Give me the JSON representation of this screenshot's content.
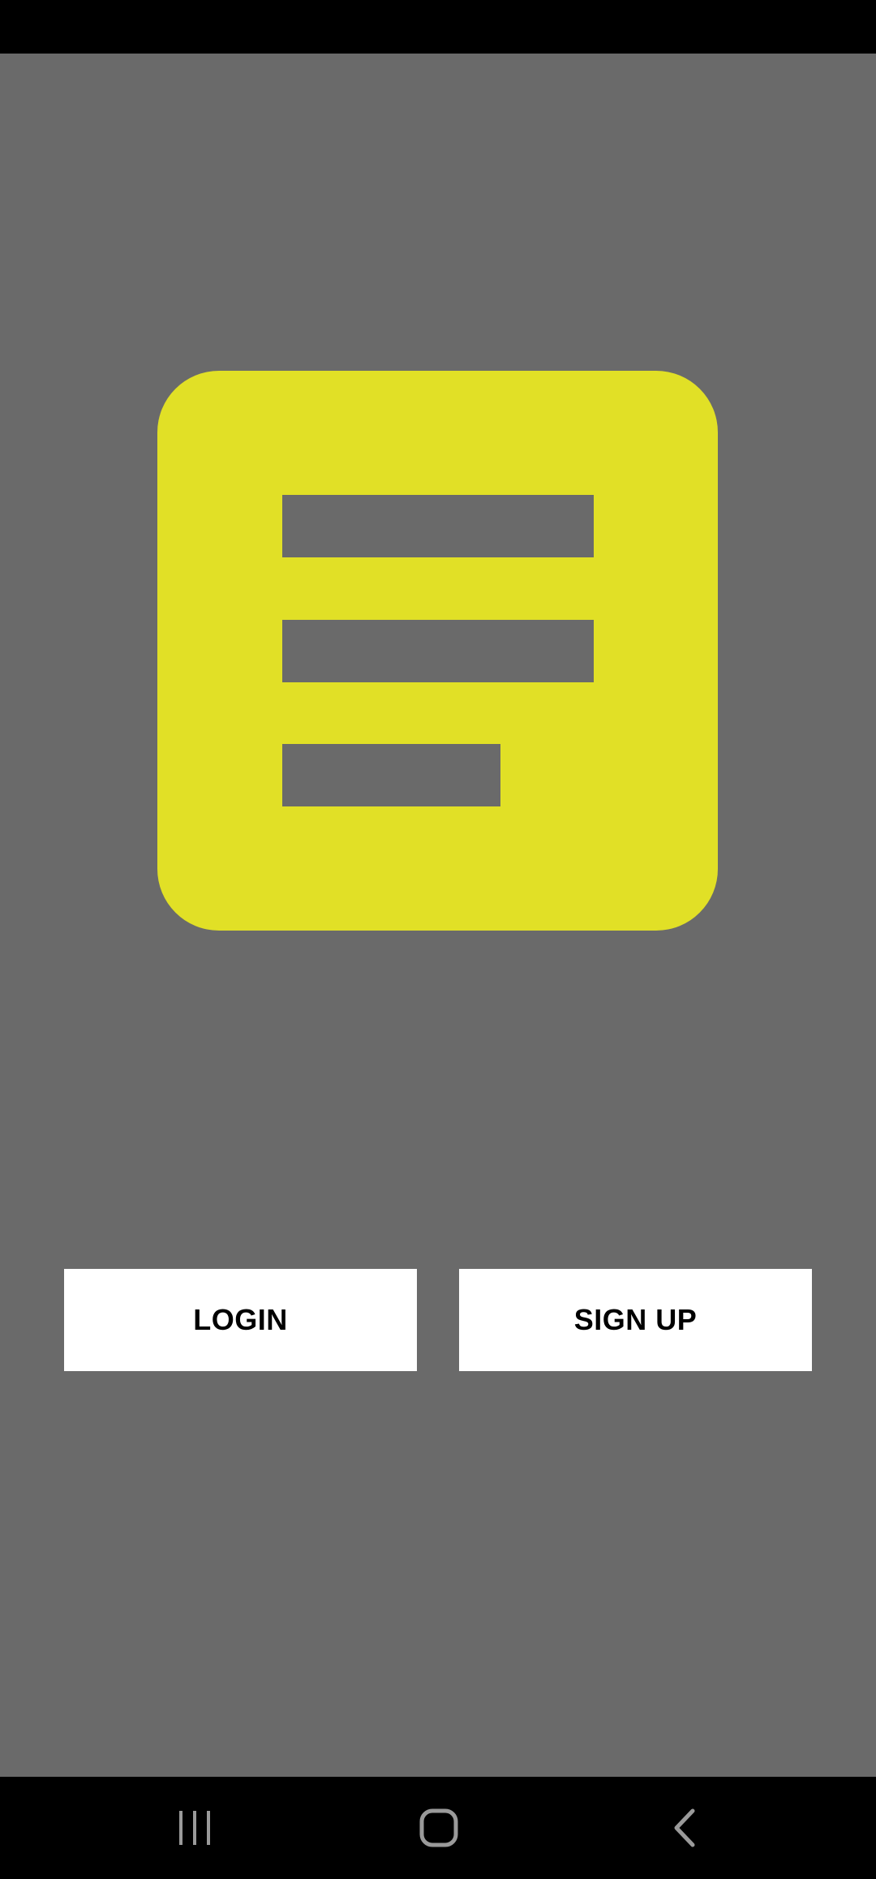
{
  "colors": {
    "background": "#6a6a6a",
    "logo": "#e1e026",
    "button_bg": "#ffffff",
    "button_text": "#000000",
    "system_bars": "#000000",
    "nav_icon": "#9a9a9a"
  },
  "logo": {
    "icon": "document-lines-icon"
  },
  "actions": {
    "login_label": "LOGIN",
    "signup_label": "SIGN UP"
  },
  "nav_bar": {
    "items": [
      {
        "icon": "recent-apps-icon"
      },
      {
        "icon": "home-icon"
      },
      {
        "icon": "back-icon"
      }
    ]
  }
}
